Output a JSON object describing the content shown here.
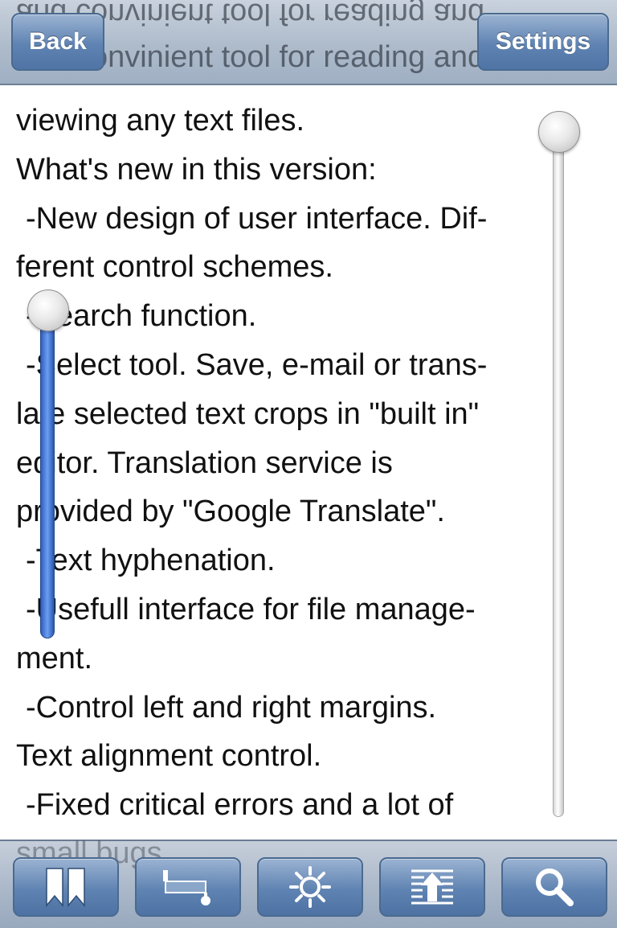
{
  "navbar": {
    "back_label": "Back",
    "settings_label": "Settings",
    "ghost_mirrored": "and convinient tool for reading and",
    "ghost_text": "and convinient tool for reading and"
  },
  "content": {
    "lines": [
      "viewing any text files.",
      "What's new in this version:",
      "-New design of user interface. Dif-",
      "ferent control schemes.",
      "-Search function.",
      "-Select tool. Save, e-mail or trans-",
      "late selected text crops in \"built in\"",
      "editor. Translation service is",
      "provided by \"Google Translate\".",
      "-Text hyphenation.",
      "-Usefull interface for file manage-",
      "ment.",
      "-Control left and right margins.",
      "Text alignment control.",
      "-Fixed critical errors and a lot of"
    ],
    "overflow_text": "small bugs."
  },
  "sliders": {
    "right_position": 0.0,
    "left_position": 0.0
  },
  "toolbar": {
    "items": [
      {
        "icon": "bookmarks-icon"
      },
      {
        "icon": "select-tool-icon"
      },
      {
        "icon": "brightness-icon"
      },
      {
        "icon": "scroll-up-icon"
      },
      {
        "icon": "search-icon"
      }
    ]
  },
  "colors": {
    "bar_blue": "#5f83b2",
    "slider_blue": "#3b6fd0"
  }
}
